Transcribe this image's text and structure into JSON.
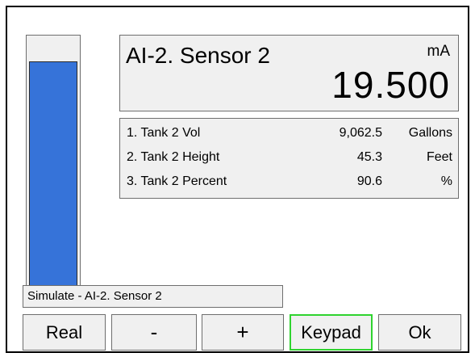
{
  "level": {
    "fraction": 0.906,
    "color": "#3673d9"
  },
  "sensor": {
    "name": "AI-2. Sensor 2",
    "unit": "mA",
    "value": "19.500"
  },
  "readings": [
    {
      "label": "1. Tank 2 Vol",
      "value": "9,062.5",
      "unit": "Gallons"
    },
    {
      "label": "2. Tank 2 Height",
      "value": "45.3",
      "unit": "Feet"
    },
    {
      "label": "3. Tank 2 Percent",
      "value": "90.6",
      "unit": "%"
    }
  ],
  "simulate_label": "Simulate - AI-2. Sensor 2",
  "buttons": {
    "real": "Real",
    "minus": "-",
    "plus": "+",
    "keypad": "Keypad",
    "ok": "Ok"
  },
  "colors": {
    "active_border": "#2fd32f",
    "panel_bg": "#f0f0f0"
  }
}
